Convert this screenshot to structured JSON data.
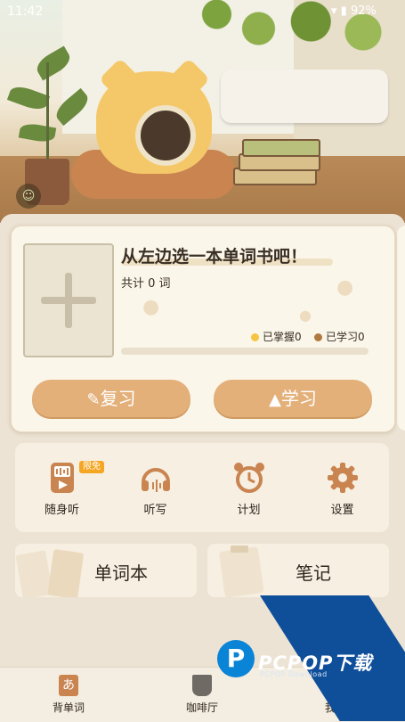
{
  "status_bar": {
    "time": "11:42",
    "battery": "92%"
  },
  "book_card": {
    "title": "从左边选一本单词书吧！",
    "word_count": "共计 0 词",
    "mastered": "已掌握0",
    "learned": "已学习0",
    "progress": 0,
    "review_label": "复习",
    "study_label": "学习"
  },
  "tools": [
    {
      "label": "随身听",
      "badge": "限免",
      "icon": "audio-player-icon"
    },
    {
      "label": "听写",
      "icon": "headphones-icon"
    },
    {
      "label": "计划",
      "icon": "alarm-clock-icon"
    },
    {
      "label": "设置",
      "icon": "gear-icon"
    }
  ],
  "tiles": {
    "wordbook": "单词本",
    "notes": "笔记"
  },
  "nav": [
    {
      "label": "背单词",
      "icon": "vocab-icon",
      "active": true
    },
    {
      "label": "咖啡厅",
      "icon": "coffee-cup-icon"
    },
    {
      "label": "我的",
      "icon": "profile-icon"
    }
  ],
  "watermark": {
    "brand": "PCPOP下载",
    "sub": "PCPOP Download"
  },
  "colors": {
    "accent": "#e4b07a",
    "mastered_dot": "#f5c542",
    "learned_dot": "#b07a3e",
    "text": "#3a2f24"
  }
}
